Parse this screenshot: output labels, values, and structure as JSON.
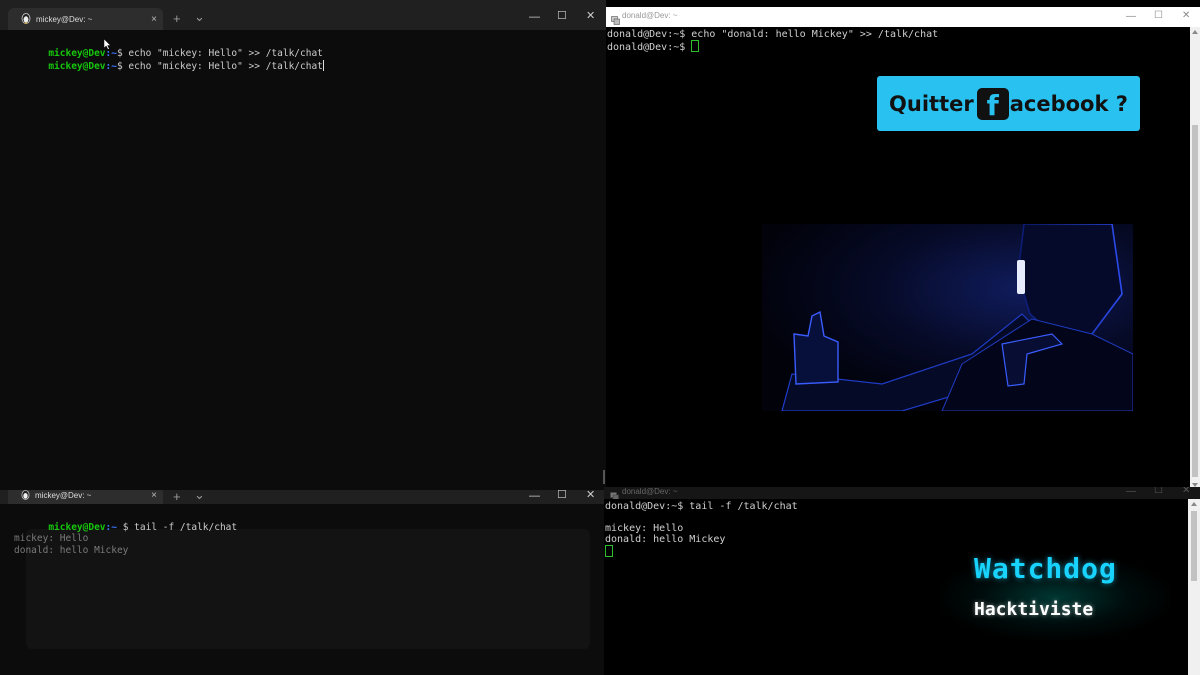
{
  "top_left": {
    "tab_title": "mickey@Dev: ~",
    "lines": [
      {
        "user": "mickey@Dev",
        "path": ":~",
        "cmd": "$ echo \"mickey: Hello\" >> /talk/chat"
      },
      {
        "user": "mickey@Dev",
        "path": ":~",
        "cmd": "$ echo \"mickey: Hello\" >> /talk/chat"
      }
    ]
  },
  "bottom_left": {
    "tab_title": "mickey@Dev: ~",
    "prompt_user": "mickey@Dev",
    "prompt_path": ":~",
    "command": "$ tail -f /talk/chat",
    "output": [
      "mickey: Hello",
      "donald: hello Mickey"
    ]
  },
  "top_right": {
    "title": "donald@Dev: ~",
    "lines": [
      "donald@Dev:~$ echo \"donald: hello Mickey\" >> /talk/chat",
      "donald@Dev:~$ "
    ]
  },
  "bottom_right": {
    "title": "donald@Dev: ~",
    "lines": [
      "donald@Dev:~$ tail -f /talk/chat",
      "",
      "mickey: Hello",
      "donald: hello Mickey"
    ]
  },
  "overlay": {
    "banner_before": "Quitter",
    "banner_logo": "f",
    "banner_after": "acebook ?",
    "banner_color": "#29c2f0",
    "watchdog": "Watchdog",
    "hacktiviste": "Hacktiviste",
    "watchdog_color": "#19d3ff"
  },
  "window_controls": {
    "tab_add": "+",
    "tab_menu": "⌄",
    "minimize": "—",
    "maximize": "☐",
    "close": "✕",
    "tab_close": "×"
  }
}
